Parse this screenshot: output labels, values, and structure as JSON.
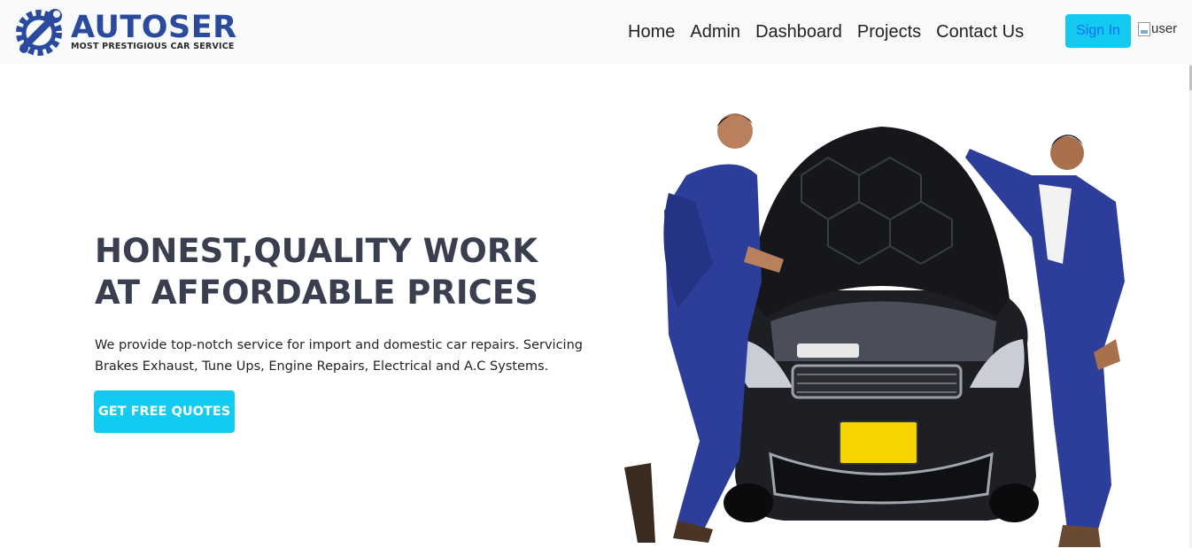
{
  "brand": {
    "name": "AUTOSER",
    "tagline": "MOST PRESTIGIOUS CAR SERVICE",
    "color": "#2a4a9e"
  },
  "nav": {
    "links": [
      "Home",
      "Admin",
      "Dashboard",
      "Projects",
      "Contact Us"
    ],
    "signin_label": "Sign In",
    "user_alt": "user"
  },
  "hero": {
    "headline_line1": "HONEST,QUALITY WORK",
    "headline_line2": "AT AFFORDABLE PRICES",
    "description": "We provide top-notch service for import and domestic car repairs. Servicing Brakes Exhaust, Tune Ups, Engine Repairs, Electrical and A.C Systems.",
    "cta_label": "GET FREE QUOTES",
    "accent": "#13caf0"
  },
  "icons": [
    "gear-wrench-logo-icon",
    "broken-image-icon"
  ]
}
